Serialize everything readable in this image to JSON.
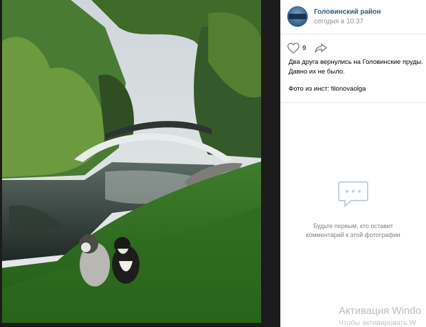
{
  "photo": {
    "alt_icon": "photo-image"
  },
  "post": {
    "group_name": "Головинский район",
    "time": "сегодня в 10:37",
    "likes": "9",
    "caption_lines": [
      "Два друга вернулись на Головинские пруды.",
      "Давно их не было."
    ],
    "credit": "Фото из инст: filonovaolga",
    "like_icon": "heart-icon",
    "share_icon": "share-arrow-icon",
    "link_color": "#2a5885"
  },
  "comments": {
    "empty_icon": "comment-bubble-icon",
    "empty_lines": [
      "Будьте первым, кто оставит",
      "комментарий к этой фотографии"
    ]
  },
  "watermark": {
    "title": "Активация Windo",
    "subtitle": "Чтобы активировать W"
  }
}
